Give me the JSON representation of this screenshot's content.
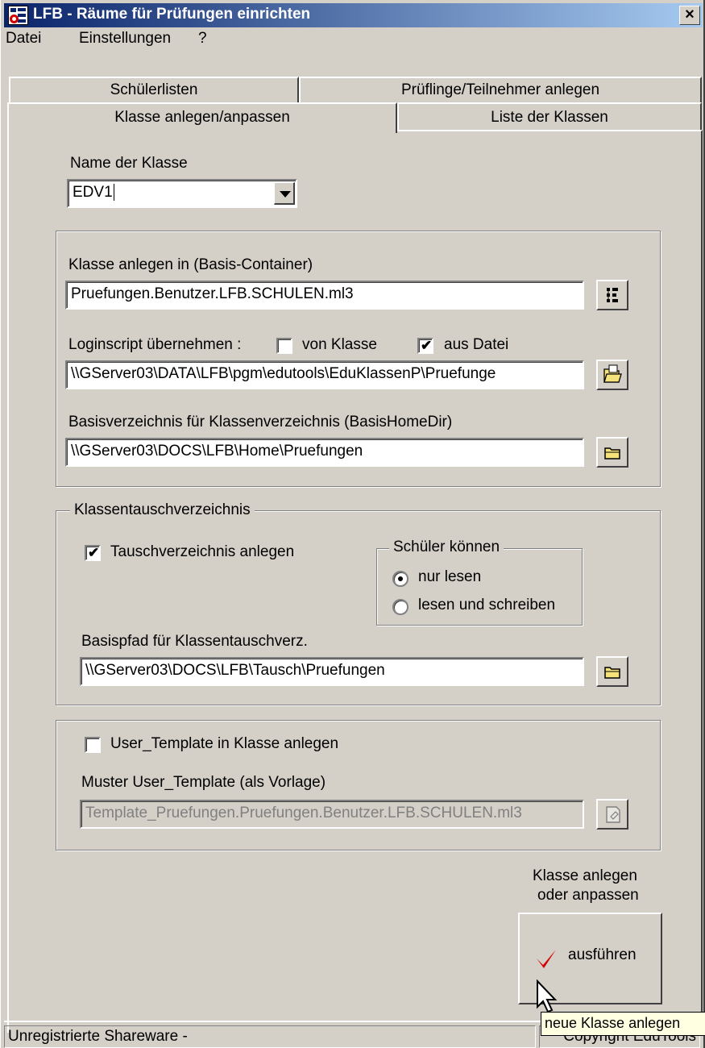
{
  "window": {
    "title": "LFB - Räume für Prüfungen einrichten",
    "close_label": "×"
  },
  "menu": {
    "items": [
      "Datei",
      "Einstellungen",
      "?"
    ]
  },
  "tabs": {
    "back": [
      "Schülerlisten",
      "Prüflinge/Teilnehmer anlegen"
    ],
    "front": [
      "Klasse anlegen/anpassen",
      "Liste der Klassen"
    ],
    "active": "Klasse anlegen/anpassen"
  },
  "class_name": {
    "label": "Name der Klasse",
    "value": "EDV1"
  },
  "base": {
    "container_label": "Klasse anlegen in (Basis-Container)",
    "container_value": "Pruefungen.Benutzer.LFB.SCHULEN.ml3",
    "loginscript_label": "Loginscript übernehmen :",
    "from_class_label": "von Klasse",
    "from_class_checked": false,
    "from_file_label": "aus Datei",
    "from_file_checked": true,
    "loginscript_value": "\\\\GServer03\\DATA\\LFB\\pgm\\edutools\\EduKlassenP\\Pruefunge",
    "homedir_label": "Basisverzeichnis für Klassenverzeichnis (BasisHomeDir)",
    "homedir_value": "\\\\GServer03\\DOCS\\LFB\\Home\\Pruefungen"
  },
  "exchange": {
    "group_label": "Klassentauschverzeichnis",
    "create_label": "Tauschverzeichnis anlegen",
    "create_checked": true,
    "students_group_label": "Schüler können",
    "read_only_label": "nur lesen",
    "read_write_label": "lesen und schreiben",
    "selected": "nur lesen",
    "path_label": "Basispfad für Klassentauschverz.",
    "path_value": "\\\\GServer03\\DOCS\\LFB\\Tausch\\Pruefungen"
  },
  "template": {
    "create_label": "User_Template in Klasse anlegen",
    "create_checked": false,
    "pattern_label": "Muster User_Template (als Vorlage)",
    "pattern_value": "Template_Pruefungen.Pruefungen.Benutzer.LFB.SCHULEN.ml3"
  },
  "action": {
    "caption_line1": "Klasse anlegen",
    "caption_line2": "oder anpassen",
    "button_label": "ausführen"
  },
  "tooltip": "neue Klasse anlegen",
  "status": {
    "left": "Unregistrierte Shareware -",
    "right": "Copyright EduTools"
  },
  "icons": {
    "tree": "tree-browse-icon",
    "open_file": "open-file-icon",
    "folder": "folder-icon",
    "template": "template-doc-icon",
    "check": "red-checkmark-icon"
  },
  "colors": {
    "face": "#d4d0c8",
    "title_start": "#0a246a",
    "title_end": "#a6caf0",
    "check_red": "#d40000",
    "tooltip_bg": "#ffffe1"
  }
}
